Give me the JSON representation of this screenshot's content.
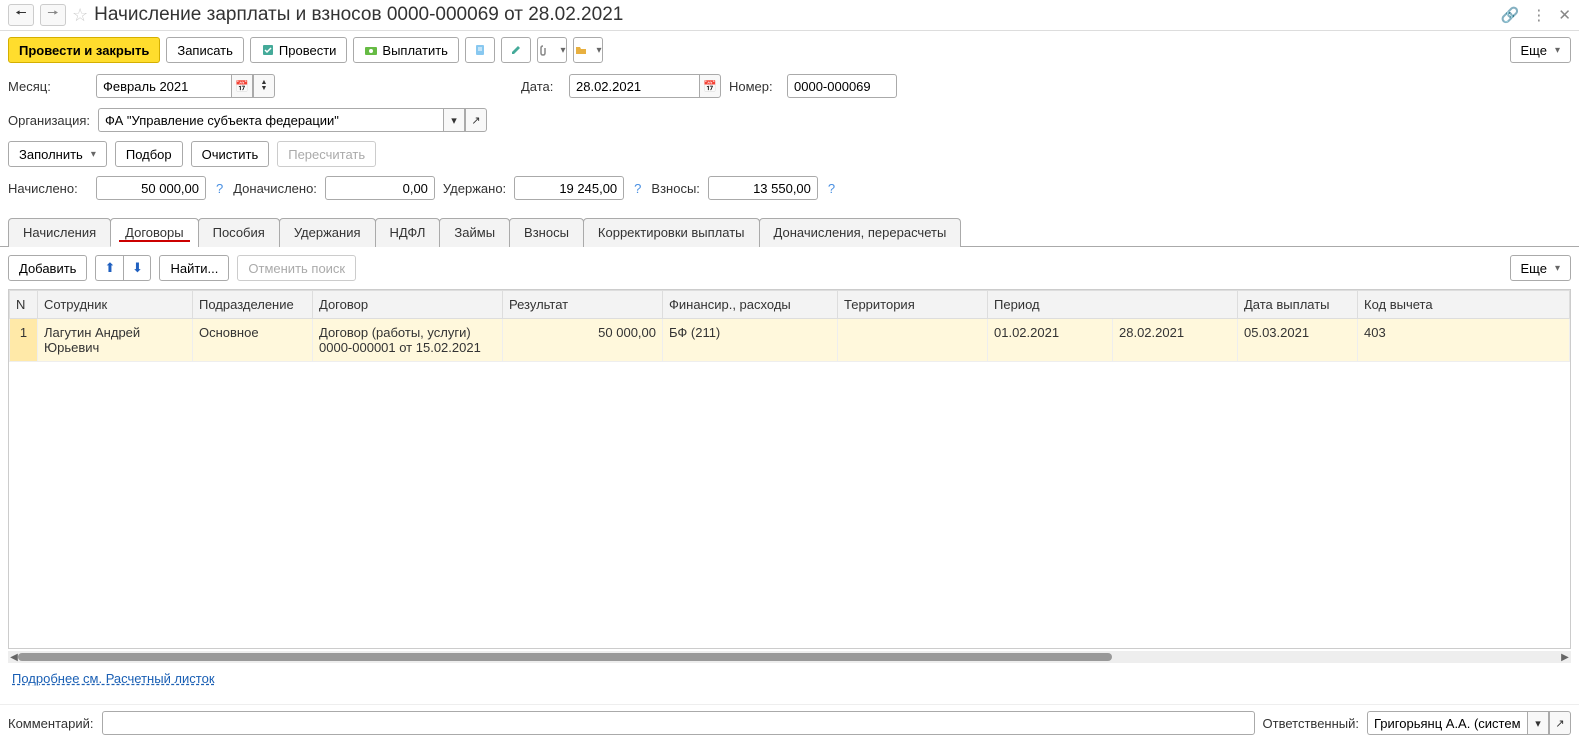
{
  "header": {
    "title": "Начисление зарплаты и взносов 0000-000069 от 28.02.2021"
  },
  "toolbar": {
    "submit_close": "Провести и закрыть",
    "save": "Записать",
    "submit": "Провести",
    "pay": "Выплатить",
    "more": "Еще"
  },
  "fields": {
    "month_label": "Месяц:",
    "month_value": "Февраль 2021",
    "date_label": "Дата:",
    "date_value": "28.02.2021",
    "number_label": "Номер:",
    "number_value": "0000-000069",
    "org_label": "Организация:",
    "org_value": "ФА \"Управление субъекта федерации\""
  },
  "actions": {
    "fill": "Заполнить",
    "select": "Подбор",
    "clear": "Очистить",
    "recalc": "Пересчитать"
  },
  "totals": {
    "accrued_label": "Начислено:",
    "accrued_value": "50 000,00",
    "add_accrued_label": "Доначислено:",
    "add_accrued_value": "0,00",
    "withheld_label": "Удержано:",
    "withheld_value": "19 245,00",
    "contrib_label": "Взносы:",
    "contrib_value": "13 550,00"
  },
  "tabs": {
    "accruals": "Начисления",
    "contracts": "Договоры",
    "benefits": "Пособия",
    "deductions": "Удержания",
    "ndfl": "НДФЛ",
    "loans": "Займы",
    "contributions": "Взносы",
    "corrections": "Корректировки выплаты",
    "recalculations": "Доначисления, перерасчеты"
  },
  "subtoolbar": {
    "add": "Добавить",
    "find": "Найти...",
    "cancel_search": "Отменить поиск",
    "more": "Еще"
  },
  "table": {
    "headers": {
      "n": "N",
      "employee": "Сотрудник",
      "department": "Подразделение",
      "contract": "Договор",
      "result": "Результат",
      "financing": "Финансир., расходы",
      "territory": "Территория",
      "period": "Период",
      "pay_date": "Дата выплаты",
      "deduction_code": "Код вычета"
    },
    "rows": [
      {
        "n": "1",
        "employee": "Лагутин Андрей Юрьевич",
        "department": "Основное",
        "contract": "Договор (работы, услуги) 0000-000001 от 15.02.2021",
        "result": "50 000,00",
        "financing": "БФ (211)",
        "territory": "",
        "period_from": "01.02.2021",
        "period_to": "28.02.2021",
        "pay_date": "05.03.2021",
        "deduction_code": "403"
      }
    ]
  },
  "link": "Подробнее см. Расчетный листок",
  "footer": {
    "comment_label": "Комментарий:",
    "comment_value": "",
    "responsible_label": "Ответственный:",
    "responsible_value": "Григорьянц А.А. (системн"
  }
}
